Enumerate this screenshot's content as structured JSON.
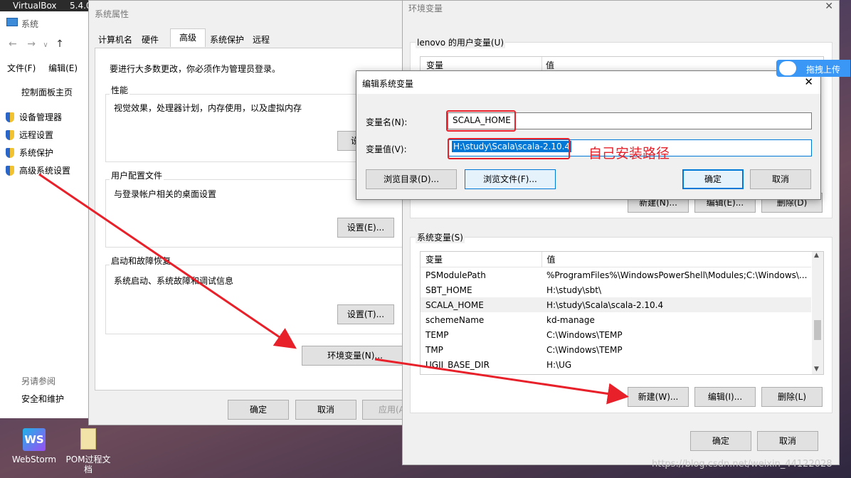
{
  "taskbar": {
    "app1": "VirtualBox",
    "app2": "5.4.0"
  },
  "system_window": {
    "title": "系统",
    "menu": [
      "文件(F)",
      "编辑(E)"
    ],
    "links": {
      "home": "控制面板主页",
      "device_manager": "设备管理器",
      "remote": "远程设置",
      "protection": "系统保护",
      "advanced": "高级系统设置"
    },
    "see_also": "另请参阅",
    "security": "安全和维护"
  },
  "sys_props": {
    "title": "系统属性",
    "tabs": [
      "计算机名",
      "硬件",
      "高级",
      "系统保护",
      "远程"
    ],
    "admin_note": "要进行大多数更改，你必须作为管理员登录。",
    "perf": {
      "title": "性能",
      "desc": "视觉效果，处理器计划，内存使用，以及虚拟内存",
      "btn": "设"
    },
    "profile": {
      "title": "用户配置文件",
      "desc": "与登录帐户相关的桌面设置",
      "btn": "设置(E)..."
    },
    "startup": {
      "title": "启动和故障恢复",
      "desc": "系统启动、系统故障和调试信息",
      "btn": "设置(T)..."
    },
    "env_btn": "环境变量(N)...",
    "ok": "确定",
    "cancel": "取消",
    "apply": "应用(A)"
  },
  "env_window": {
    "title": "环境变量",
    "user_group": "lenovo 的用户变量(U)",
    "col_var": "变量",
    "col_val": "值",
    "user_buttons": {
      "new": "新建(N)...",
      "edit": "编辑(E)...",
      "delete": "删除(D)"
    },
    "sys_group": "系统变量(S)",
    "sys_rows": [
      {
        "name": "PSModulePath",
        "value": "%ProgramFiles%\\WindowsPowerShell\\Modules;C:\\Windows\\..."
      },
      {
        "name": "SBT_HOME",
        "value": "H:\\study\\sbt\\"
      },
      {
        "name": "SCALA_HOME",
        "value": "H:\\study\\Scala\\scala-2.10.4"
      },
      {
        "name": "schemeName",
        "value": "kd-manage"
      },
      {
        "name": "TEMP",
        "value": "C:\\Windows\\TEMP"
      },
      {
        "name": "TMP",
        "value": "C:\\Windows\\TEMP"
      },
      {
        "name": "UGII_BASE_DIR",
        "value": "H:\\UG"
      }
    ],
    "sys_buttons": {
      "new": "新建(W)...",
      "edit": "编辑(I)...",
      "delete": "删除(L)"
    },
    "ok": "确定",
    "cancel": "取消"
  },
  "edit_dialog": {
    "title": "编辑系统变量",
    "name_label": "变量名(N):",
    "name_value": "SCALA_HOME",
    "value_label": "变量值(V):",
    "value_value": "H:\\study\\Scala\\scala-2.10.4",
    "annotation": "自己安装路径",
    "browse_dir": "浏览目录(D)...",
    "browse_file": "浏览文件(F)...",
    "ok": "确定",
    "cancel": "取消"
  },
  "upload_badge": "拖拽上传",
  "desktop": {
    "icon1": "WebStorm",
    "icon2": "POM过程文档"
  },
  "watermark": "https://blog.csdn.net/weixin_44122028",
  "colors": {
    "accent": "#0078d7",
    "annotation_red": "#e8202a",
    "selection": "#0078d7"
  }
}
